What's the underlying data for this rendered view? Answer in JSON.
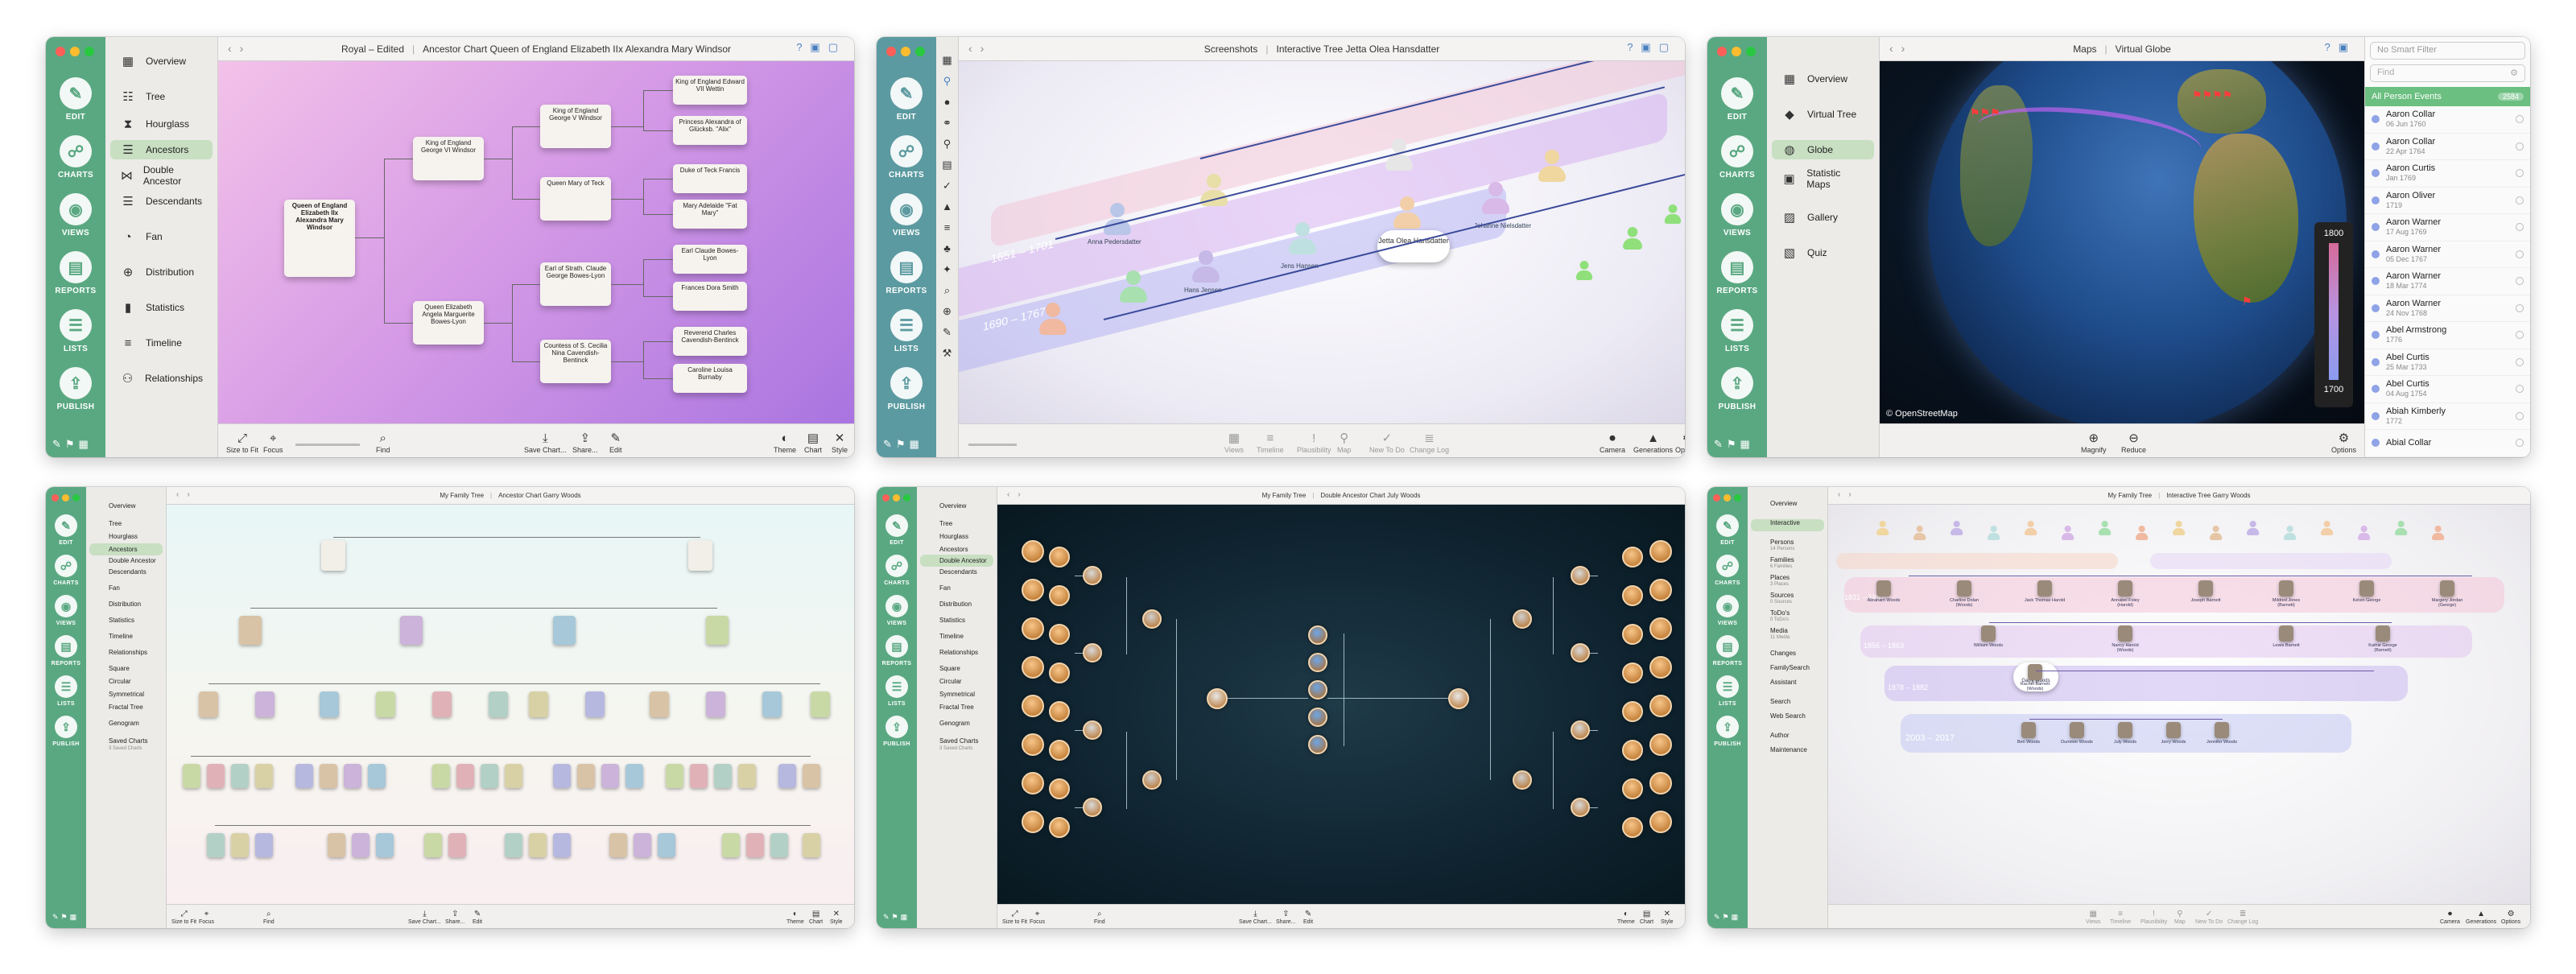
{
  "rail": {
    "edit": "EDIT",
    "charts": "CHARTS",
    "views": "VIEWS",
    "reports": "REPORTS",
    "lists": "LISTS",
    "publish": "PUBLISH"
  },
  "charts_menu": [
    "Overview",
    "Tree",
    "Hourglass",
    "Ancestors",
    "Double Ancestor",
    "Descendants",
    "Fan",
    "Distribution",
    "Statistics",
    "Timeline",
    "Relationships"
  ],
  "charts_menu_small": [
    "Overview",
    "Tree",
    "Hourglass",
    "Ancestors",
    "Double Ancestor",
    "Descendants",
    "Fan",
    "Distribution",
    "Statistics",
    "Timeline",
    "Relationships",
    "Square",
    "Circular",
    "Symmetrical",
    "Fractal Tree",
    "Genogram",
    "Saved Charts"
  ],
  "saved_charts_sub": "3 Saved Charts",
  "views_menu": [
    "Overview",
    "Virtual Tree",
    "Globe",
    "Statistic Maps",
    "Gallery",
    "Quiz"
  ],
  "views_small_menu": [
    "Overview",
    "Interactive",
    "Persons",
    "Families",
    "Places",
    "Sources",
    "ToDo's",
    "Media",
    "Changes",
    "FamilySearch",
    "Assistant",
    "Search",
    "Web Search",
    "Author",
    "Maintenance"
  ],
  "views_small_sub": [
    "",
    "",
    "14 Persons",
    "6 Families",
    "3 Places",
    "0 Sources",
    "0 ToDo's",
    "11 Media",
    "",
    "",
    "",
    "",
    "",
    "",
    ""
  ],
  "windows": {
    "w1": {
      "doc": "Royal – Edited",
      "title": "Ancestor Chart Queen of England Elizabeth IIx Alexandra Mary Windsor"
    },
    "w2": {
      "doc": "Screenshots",
      "title": "Interactive Tree Jetta Olea Hansdatter"
    },
    "w3": {
      "doc": "Maps",
      "title": "Virtual Globe"
    },
    "w4": {
      "doc": "My Family Tree",
      "title": "Ancestor Chart Garry Woods"
    },
    "w5": {
      "doc": "My Family Tree",
      "title": "Double Ancestor Chart July Woods"
    },
    "w6": {
      "doc": "My Family Tree",
      "title": "Interactive Tree Garry Woods"
    }
  },
  "toolbar_chart": [
    "Size to Fit",
    "Focus",
    "Find",
    "Save Chart...",
    "Share...",
    "Edit",
    "Theme",
    "Chart",
    "Style"
  ],
  "toolbar_interactive": [
    "Views",
    "Timeline",
    "Plausibility",
    "Map",
    "New To Do",
    "Change Log",
    "Camera",
    "Generations",
    "Options"
  ],
  "toolbar_globe": [
    "Magnify",
    "Reduce",
    "Options"
  ],
  "w1_cards": {
    "root": "Queen of England Elizabeth IIx Alexandra Mary Windsor",
    "p1": "King of England George VI Windsor",
    "p2": "Queen Elizabeth Angela Marguerite Bowes-Lyon",
    "g1": "King of England George V Windsor",
    "g2": "Queen Mary of Teck",
    "g3": "Earl of Strath. Claude George Bowes-Lyon",
    "g4": "Countess of S. Cecilia Nina Cavendish-Bentinck",
    "gg1": "King of England Edward VII Wettin",
    "gg2": "Princess Alexandra of Glücksb. \"Alix\"",
    "gg3": "Duke of Teck Francis",
    "gg4": "Mary Adelaide \"Fat Mary\"",
    "gg5": "Earl Claude Bowes-Lyon",
    "gg6": "Frances Dora Smith",
    "gg7": "Reverend Charles Cavendish-Bentinck",
    "gg8": "Caroline Louisa Burnaby"
  },
  "w2_bands": [
    "1651 – 1701",
    "1690 – 1767"
  ],
  "w2_names": [
    "Jetta Olea Hansdatter",
    "Jens Hansen",
    "Johanne Nielsdatter",
    "Hans Jensen",
    "Anna Pedersdatter"
  ],
  "w3": {
    "filter_placeholder": "No Smart Filter",
    "find_placeholder": "Find",
    "group": "All Person Events",
    "group_count": "2584",
    "scale_top": "1800",
    "scale_bottom": "1700",
    "credit": "© OpenStreetMap",
    "persons": [
      {
        "name": "Aaron Collar",
        "date": "06 Jun 1760"
      },
      {
        "name": "Aaron Collar",
        "date": "22 Apr 1764"
      },
      {
        "name": "Aaron Curtis",
        "date": "Jan 1769"
      },
      {
        "name": "Aaron Oliver",
        "date": "1719"
      },
      {
        "name": "Aaron Warner",
        "date": "17 Aug 1769"
      },
      {
        "name": "Aaron Warner",
        "date": "05 Dec 1767"
      },
      {
        "name": "Aaron Warner",
        "date": "18 Mar 1774"
      },
      {
        "name": "Aaron Warner",
        "date": "24 Nov 1768"
      },
      {
        "name": "Abel Armstrong",
        "date": "1776"
      },
      {
        "name": "Abel Curtis",
        "date": "25 Mar 1733"
      },
      {
        "name": "Abel Curtis",
        "date": "04 Aug 1754"
      },
      {
        "name": "Abiah Kimberly",
        "date": "1772"
      },
      {
        "name": "Abial Collar",
        "date": ""
      }
    ]
  },
  "w6_bands": [
    "1831 – 1847",
    "1856 – 1863",
    "1878 – 1882",
    "2003 – 2017"
  ],
  "w6_names": {
    "center": "Garry Woods",
    "spouse": "Rachel Barnett (Woods)",
    "parents": [
      "William Woods",
      "Nancy Harold (Woods)",
      "Lewis Barnett",
      "Kathie George (Barnett)"
    ],
    "grand": [
      "Abraham Woods",
      "Charlice Dolan (Woods)",
      "Jack Thomas Harold",
      "Annabel Foley (Harold)",
      "Joseph Barnett",
      "Mildred Jones (Barnett)",
      "Kelvin George",
      "Margery Jordan (George)"
    ],
    "kids": [
      "Ben Woods",
      "Dummer Woods",
      "July Woods",
      "Jerry Woods",
      "Jennifer Woods"
    ]
  },
  "colors": {
    "rail_green": "#5aa882",
    "rail_teal": "#5b9aa0",
    "accent_blue": "#4a7fbf"
  }
}
